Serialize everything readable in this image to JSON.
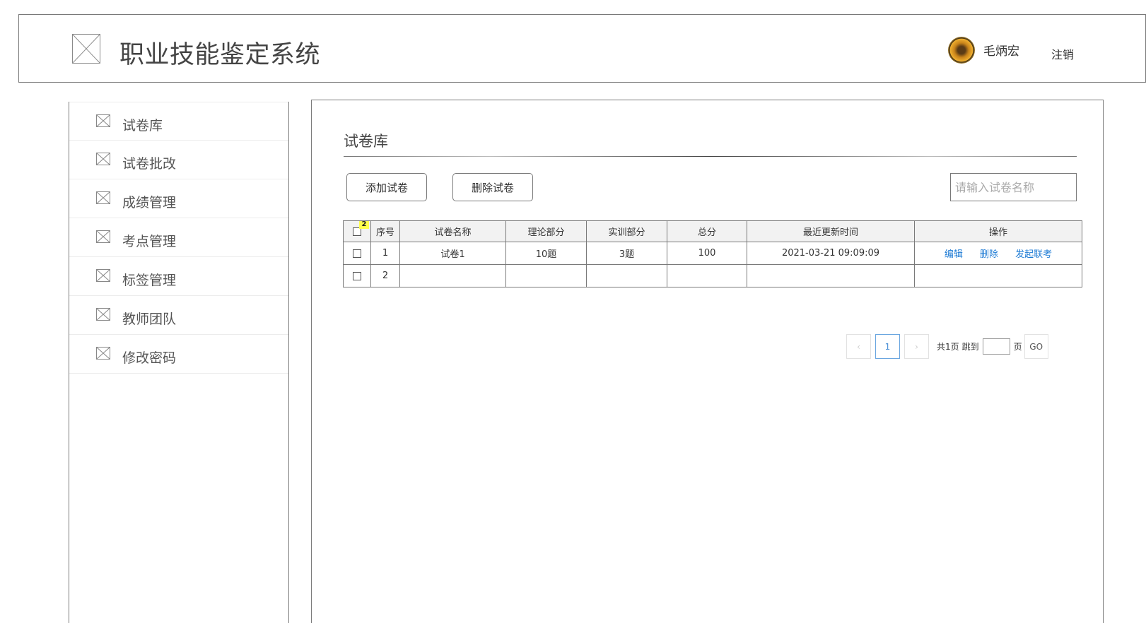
{
  "header": {
    "app_title": "职业技能鉴定系统",
    "logo_icon": "image-placeholder-icon",
    "username": "毛炳宏",
    "logout_label": "注销"
  },
  "sidebar": {
    "items": [
      {
        "label": "试卷库",
        "icon": "image-placeholder-icon"
      },
      {
        "label": "试卷批改",
        "icon": "image-placeholder-icon"
      },
      {
        "label": "成绩管理",
        "icon": "image-placeholder-icon"
      },
      {
        "label": "考点管理",
        "icon": "image-placeholder-icon"
      },
      {
        "label": "标签管理",
        "icon": "image-placeholder-icon"
      },
      {
        "label": "教师团队",
        "icon": "image-placeholder-icon"
      },
      {
        "label": "修改密码",
        "icon": "image-placeholder-icon"
      }
    ]
  },
  "main": {
    "page_title": "试卷库",
    "add_button": "添加试卷",
    "delete_button": "删除试卷",
    "search": {
      "placeholder": "请输入试卷名称",
      "value": ""
    },
    "table": {
      "checkbox_badge": "2",
      "headers": {
        "index": "序号",
        "name": "试卷名称",
        "theory": "理论部分",
        "practice": "实训部分",
        "total": "总分",
        "updated": "最近更新时间",
        "ops": "操作"
      },
      "rows": [
        {
          "index": "1",
          "name": "试卷1",
          "theory": "10题",
          "practice": "3题",
          "total": "100",
          "updated": "2021-03-21 09:09:09",
          "checked": false
        },
        {
          "index": "2",
          "name": "",
          "theory": "",
          "practice": "",
          "total": "",
          "updated": "",
          "checked": false
        }
      ],
      "ops": {
        "edit": "编辑",
        "delete": "删除",
        "launch_exam": "发起联考"
      }
    },
    "pagination": {
      "prev": "‹",
      "current_page": "1",
      "next": "›",
      "total_text": "共1页",
      "jump_label": "跳到",
      "page_unit": "页",
      "go_label": "GO",
      "link_color": "#4a90d6"
    }
  },
  "colors": {
    "border": "#797979",
    "link": "#1e7bd4",
    "badge": "#ffff4d",
    "header_bg": "#f2f2f2"
  }
}
